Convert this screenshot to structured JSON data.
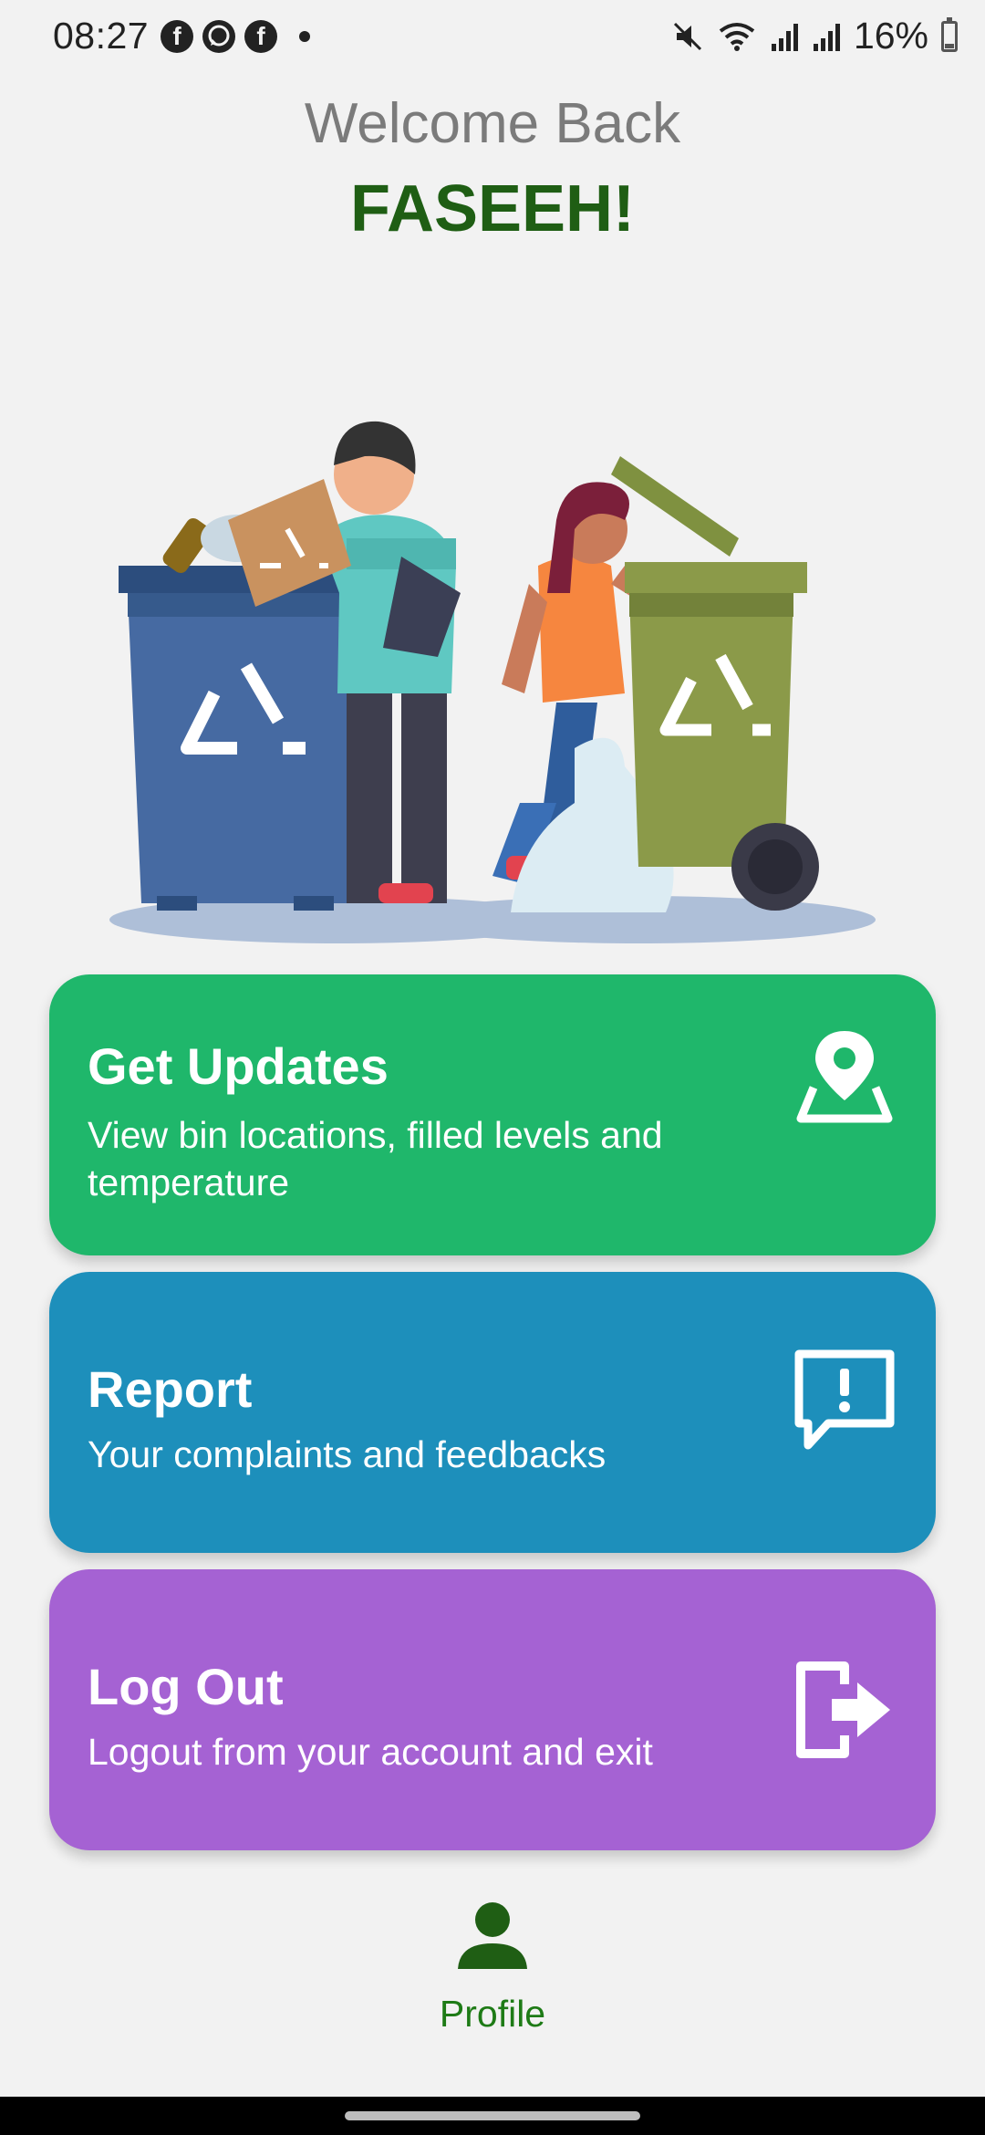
{
  "status_bar": {
    "time": "08:27",
    "battery": "16%",
    "left_icons": [
      "facebook-icon",
      "whatsapp-icon",
      "facebook-icon"
    ],
    "right_icons": [
      "mute-icon",
      "wifi-icon",
      "signal-icon",
      "signal-icon",
      "battery-icon"
    ]
  },
  "header": {
    "welcome": "Welcome Back",
    "username": "FASEEH!"
  },
  "cards": [
    {
      "title": "Get Updates",
      "subtitle": "View bin locations, filled levels and temperature",
      "icon": "location-pin-icon",
      "color": "#1fb76b"
    },
    {
      "title": "Report",
      "subtitle": "Your complaints and feedbacks",
      "icon": "report-message-icon",
      "color": "#1d8fbb"
    },
    {
      "title": "Log Out",
      "subtitle": "Logout from your account and exit",
      "icon": "logout-icon",
      "color": "#a562d3"
    }
  ],
  "nav": {
    "profile_label": "Profile",
    "profile_icon": "person-icon",
    "accent": "#1e7b16"
  },
  "colors": {
    "background": "#f2f2f2",
    "username": "#1f5e14",
    "welcome": "#7b7b7b"
  }
}
